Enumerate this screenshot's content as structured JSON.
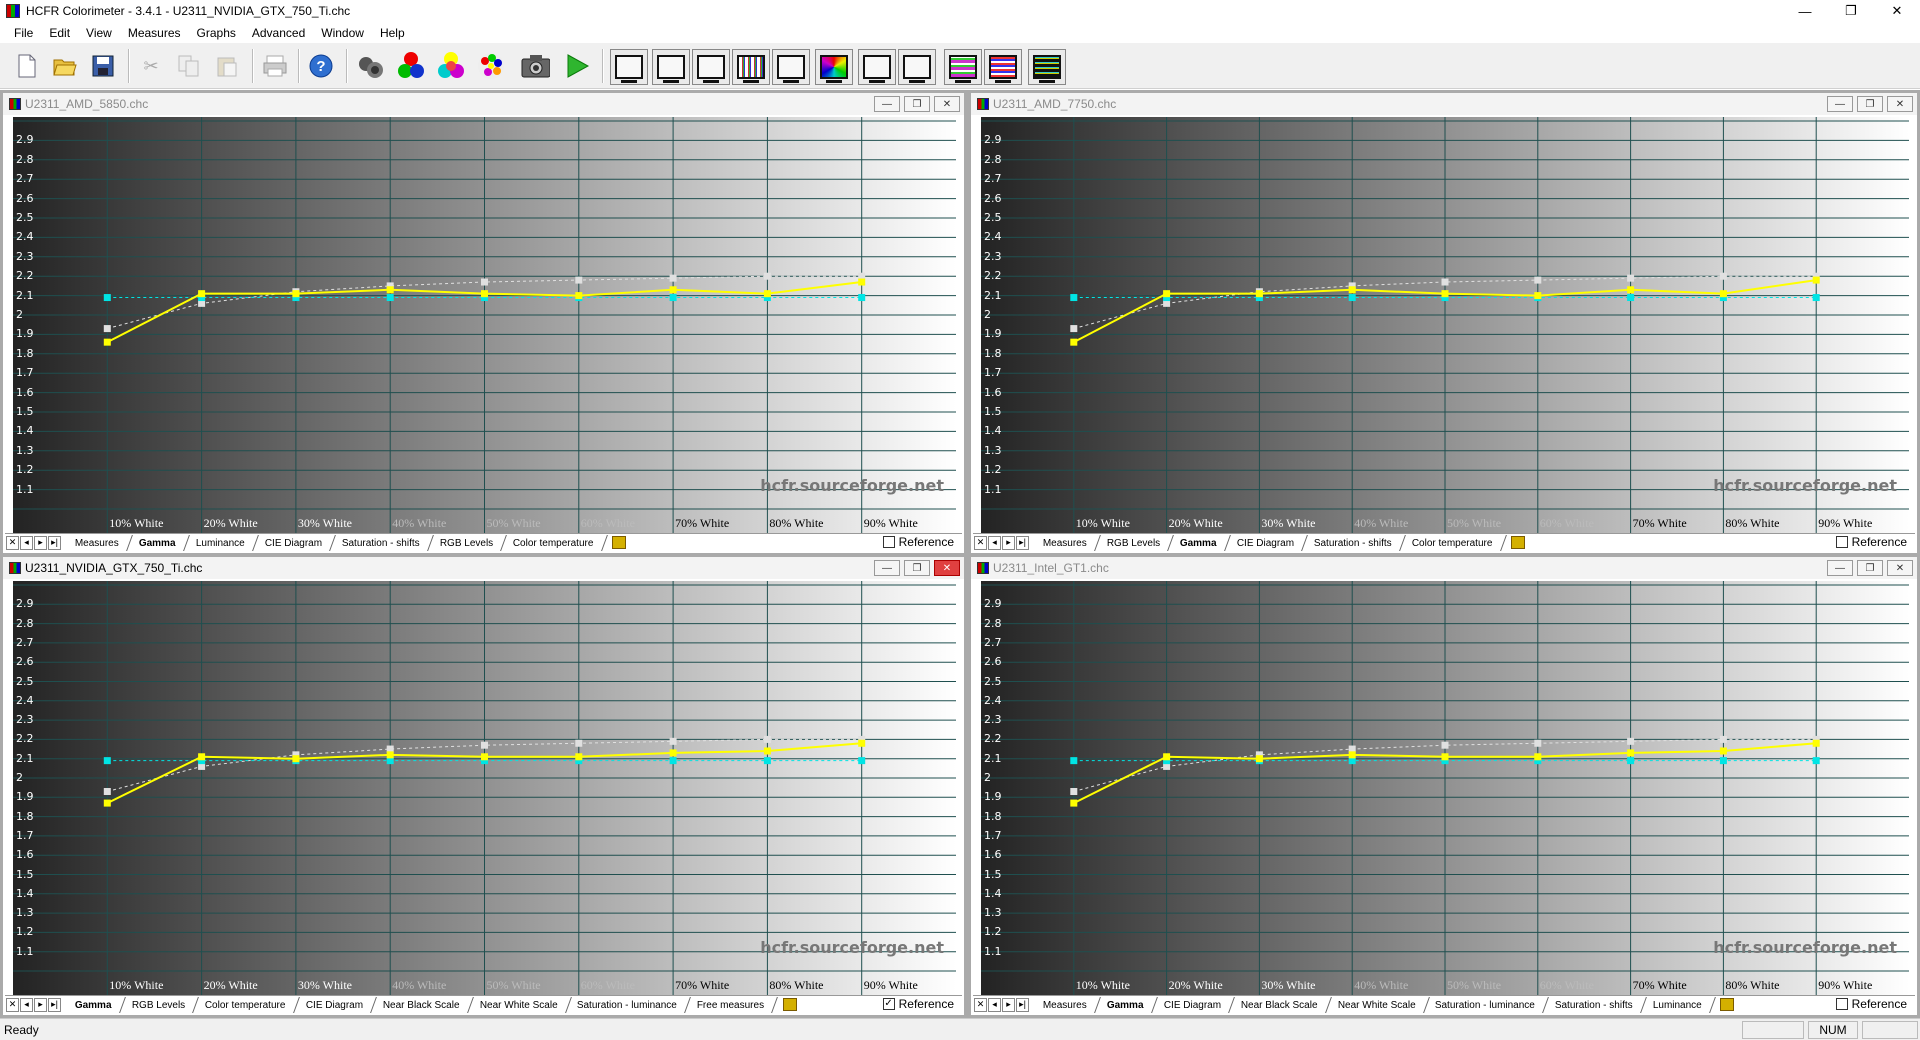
{
  "window": {
    "title": "HCFR Colorimeter - 3.4.1 - U2311_NVIDIA_GTX_750_Ti.chc",
    "minimize": "—",
    "restore": "❐",
    "close": "✕"
  },
  "menu": [
    "File",
    "Edit",
    "View",
    "Measures",
    "Graphs",
    "Advanced",
    "Window",
    "Help"
  ],
  "toolbar": {
    "standard": [
      "new-icon",
      "open-icon",
      "save-icon",
      "cut-icon",
      "copy-icon",
      "paste-icon",
      "print-icon",
      "help-icon"
    ],
    "measure": [
      "sensor-icon",
      "rgb-primaries-icon",
      "secondaries-icon",
      "color-palette-icon",
      "camera-icon",
      "play-icon"
    ],
    "graphs": [
      "graph-measures-icon",
      "graph-gamma-icon",
      "graph-luminance-icon",
      "graph-rgb-levels-icon",
      "graph-color-temp-icon",
      "graph-cie-icon",
      "graph-near-black-icon",
      "graph-near-white-icon",
      "graph-saturation-icon",
      "graph-sat-shifts-icon",
      "graph-free-icon"
    ]
  },
  "colors": {
    "measured": "#ffff00",
    "reference": "#00e5e5",
    "secondary": "#e0e0e0",
    "grid": "#1f4f4f"
  },
  "panels": [
    {
      "title": "U2311_AMD_5850.chc",
      "active": false,
      "tabs": [
        "Measures",
        "Gamma",
        "Luminance",
        "CIE Diagram",
        "Saturation - shifts",
        "RGB Levels",
        "Color temperature"
      ],
      "selected_tab": "Gamma",
      "reference_label": "Reference",
      "reference_checked": false,
      "watermark": "hcfr.sourceforge.net",
      "buttons": {
        "min": "—",
        "max": "❐",
        "close": "✕"
      }
    },
    {
      "title": "U2311_AMD_7750.chc",
      "active": false,
      "tabs": [
        "Measures",
        "RGB Levels",
        "Gamma",
        "CIE Diagram",
        "Saturation - shifts",
        "Color temperature"
      ],
      "selected_tab": "Gamma",
      "reference_label": "Reference",
      "reference_checked": false,
      "watermark": "hcfr.sourceforge.net",
      "buttons": {
        "min": "—",
        "max": "❐",
        "close": "✕"
      }
    },
    {
      "title": "U2311_NVIDIA_GTX_750_Ti.chc",
      "active": true,
      "tabs": [
        "Gamma",
        "RGB Levels",
        "Color temperature",
        "CIE Diagram",
        "Near Black Scale",
        "Near White Scale",
        "Saturation - luminance",
        "Free measures"
      ],
      "selected_tab": "Gamma",
      "reference_label": "Reference",
      "reference_checked": true,
      "watermark": "hcfr.sourceforge.net",
      "buttons": {
        "min": "—",
        "max": "❐",
        "close": "✕"
      }
    },
    {
      "title": "U2311_Intel_GT1.chc",
      "active": false,
      "tabs": [
        "Measures",
        "Gamma",
        "CIE Diagram",
        "Near Black Scale",
        "Near White Scale",
        "Saturation - luminance",
        "Saturation - shifts",
        "Luminance"
      ],
      "selected_tab": "Gamma",
      "reference_label": "Reference",
      "reference_checked": false,
      "watermark": "hcfr.sourceforge.net",
      "buttons": {
        "min": "—",
        "max": "❐",
        "close": "✕"
      }
    }
  ],
  "chart_data": [
    {
      "type": "line",
      "title": "U2311_AMD_5850.chc",
      "categories": [
        "10% White",
        "20% White",
        "30% White",
        "40% White",
        "50% White",
        "60% White",
        "70% White",
        "80% White",
        "90% White"
      ],
      "yticks": [
        "2.9",
        "2.8",
        "2.7",
        "2.6",
        "2.5",
        "2.4",
        "2.3",
        "2.2",
        "2.1",
        "2",
        "1.9",
        "1.8",
        "1.7",
        "1.6",
        "1.5",
        "1.4",
        "1.3",
        "1.2",
        "1.1"
      ],
      "ylim": [
        1.0,
        3.0
      ],
      "series": [
        {
          "color": "#ffff00",
          "values": [
            1.86,
            2.11,
            2.11,
            2.13,
            2.11,
            2.1,
            2.13,
            2.11,
            2.17
          ]
        },
        {
          "color": "#00e5e5",
          "values": [
            2.09,
            2.09,
            2.09,
            2.09,
            2.09,
            2.09,
            2.09,
            2.09,
            2.09
          ]
        },
        {
          "color": "#e0e0e0",
          "values": [
            1.93,
            2.06,
            2.12,
            2.15,
            2.17,
            2.18,
            2.19,
            2.2,
            2.2
          ]
        }
      ]
    },
    {
      "type": "line",
      "title": "U2311_AMD_7750.chc",
      "categories": [
        "10% White",
        "20% White",
        "30% White",
        "40% White",
        "50% White",
        "60% White",
        "70% White",
        "80% White",
        "90% White"
      ],
      "yticks": [
        "2.9",
        "2.8",
        "2.7",
        "2.6",
        "2.5",
        "2.4",
        "2.3",
        "2.2",
        "2.1",
        "2",
        "1.9",
        "1.8",
        "1.7",
        "1.6",
        "1.5",
        "1.4",
        "1.3",
        "1.2",
        "1.1"
      ],
      "ylim": [
        1.0,
        3.0
      ],
      "series": [
        {
          "color": "#ffff00",
          "values": [
            1.86,
            2.11,
            2.11,
            2.13,
            2.11,
            2.1,
            2.13,
            2.11,
            2.18
          ]
        },
        {
          "color": "#00e5e5",
          "values": [
            2.09,
            2.09,
            2.09,
            2.09,
            2.09,
            2.09,
            2.09,
            2.09,
            2.09
          ]
        },
        {
          "color": "#e0e0e0",
          "values": [
            1.93,
            2.06,
            2.12,
            2.15,
            2.17,
            2.18,
            2.19,
            2.2,
            2.2
          ]
        }
      ]
    },
    {
      "type": "line",
      "title": "U2311_NVIDIA_GTX_750_Ti.chc",
      "categories": [
        "10% White",
        "20% White",
        "30% White",
        "40% White",
        "50% White",
        "60% White",
        "70% White",
        "80% White",
        "90% White"
      ],
      "yticks": [
        "2.9",
        "2.8",
        "2.7",
        "2.6",
        "2.5",
        "2.4",
        "2.3",
        "2.2",
        "2.1",
        "2",
        "1.9",
        "1.8",
        "1.7",
        "1.6",
        "1.5",
        "1.4",
        "1.3",
        "1.2",
        "1.1"
      ],
      "ylim": [
        1.0,
        3.0
      ],
      "series": [
        {
          "color": "#ffff00",
          "values": [
            1.87,
            2.11,
            2.1,
            2.12,
            2.11,
            2.11,
            2.13,
            2.14,
            2.18
          ]
        },
        {
          "color": "#00e5e5",
          "values": [
            2.09,
            2.09,
            2.09,
            2.09,
            2.09,
            2.09,
            2.09,
            2.09,
            2.09
          ]
        },
        {
          "color": "#e0e0e0",
          "values": [
            1.93,
            2.06,
            2.12,
            2.15,
            2.17,
            2.18,
            2.19,
            2.2,
            2.2
          ]
        }
      ]
    },
    {
      "type": "line",
      "title": "U2311_Intel_GT1.chc",
      "categories": [
        "10% White",
        "20% White",
        "30% White",
        "40% White",
        "50% White",
        "60% White",
        "70% White",
        "80% White",
        "90% White"
      ],
      "yticks": [
        "2.9",
        "2.8",
        "2.7",
        "2.6",
        "2.5",
        "2.4",
        "2.3",
        "2.2",
        "2.1",
        "2",
        "1.9",
        "1.8",
        "1.7",
        "1.6",
        "1.5",
        "1.4",
        "1.3",
        "1.2",
        "1.1"
      ],
      "ylim": [
        1.0,
        3.0
      ],
      "series": [
        {
          "color": "#ffff00",
          "values": [
            1.87,
            2.11,
            2.1,
            2.12,
            2.11,
            2.11,
            2.13,
            2.14,
            2.18
          ]
        },
        {
          "color": "#00e5e5",
          "values": [
            2.09,
            2.09,
            2.09,
            2.09,
            2.09,
            2.09,
            2.09,
            2.09,
            2.09
          ]
        },
        {
          "color": "#e0e0e0",
          "values": [
            1.93,
            2.06,
            2.12,
            2.15,
            2.17,
            2.18,
            2.19,
            2.2,
            2.2
          ]
        }
      ]
    }
  ],
  "status": {
    "text": "Ready",
    "num": "NUM"
  }
}
